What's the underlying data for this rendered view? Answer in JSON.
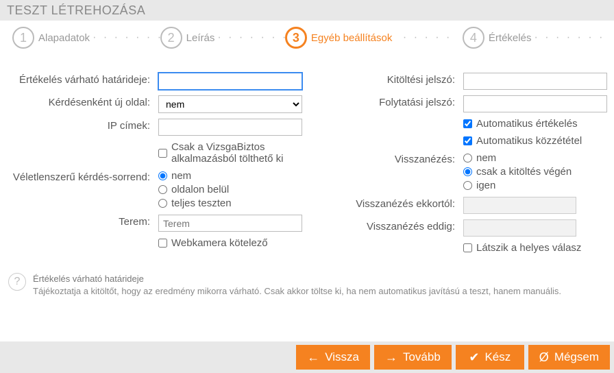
{
  "header": {
    "title": "TESZT LÉTREHOZÁSA"
  },
  "steps": [
    {
      "num": "1",
      "label": "Alapadatok"
    },
    {
      "num": "2",
      "label": "Leírás"
    },
    {
      "num": "3",
      "label": "Egyéb beállítások"
    },
    {
      "num": "4",
      "label": "Értékelés"
    }
  ],
  "form": {
    "deadline_label": "Értékelés várható határideje:",
    "newpage_label": "Kérdésenként új oldal:",
    "newpage_value": "nem",
    "ip_label": "IP címek:",
    "vizsgabiztos": "Csak a VizsgaBiztos alkalmazásból tölthető ki",
    "random_label": "Véletlenszerű kérdés-sorrend:",
    "random_opts": {
      "none": "nem",
      "page": "oldalon belül",
      "full": "teljes teszten"
    },
    "room_label": "Terem:",
    "room_placeholder": "Terem",
    "webcam": "Webkamera kötelező",
    "fill_pwd_label": "Kitöltési jelszó:",
    "cont_pwd_label": "Folytatási jelszó:",
    "auto_eval": "Automatikus értékelés",
    "auto_publish": "Automatikus közzététel",
    "lookback_label": "Visszanézés:",
    "lookback_opts": {
      "none": "nem",
      "end": "csak a kitöltés végén",
      "yes": "igen"
    },
    "lookback_from_label": "Visszanézés ekkortól:",
    "lookback_to_label": "Visszanézés eddig:",
    "show_correct": "Látszik a helyes válasz"
  },
  "help": {
    "title": "Értékelés várható határideje",
    "body": "Tájékoztatja a kitöltőt, hogy az eredmény mikorra várható. Csak akkor töltse ki, ha nem automatikus javítású a teszt, hanem manuális."
  },
  "footer": {
    "back": "Vissza",
    "next": "Tovább",
    "done": "Kész",
    "cancel": "Mégsem"
  }
}
